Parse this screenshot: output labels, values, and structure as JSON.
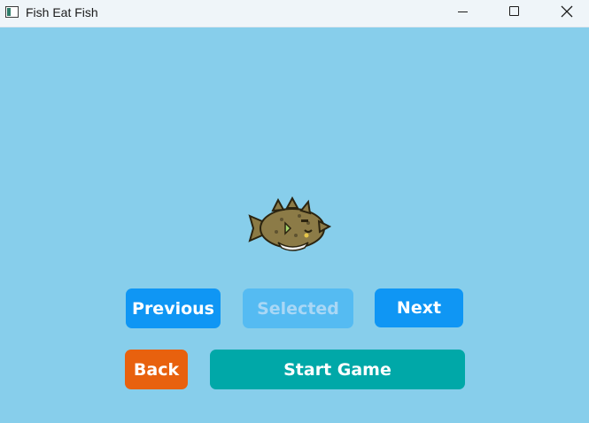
{
  "window": {
    "title": "Fish Eat Fish",
    "icon": "app-window-icon",
    "controls": [
      "minimize-icon",
      "maximize-icon",
      "close-icon"
    ]
  },
  "background_color": "#87CEEB",
  "selection": {
    "fish_sprite": "pufferfish-icon"
  },
  "buttons": {
    "previous": "Previous",
    "selected": "Selected",
    "next": "Next",
    "back": "Back",
    "start_game": "Start Game"
  },
  "colors": {
    "nav_button": "#0F96F4",
    "selected_button": "#55BBF2",
    "back_button": "#E8610E",
    "start_button": "#00A8A8"
  }
}
